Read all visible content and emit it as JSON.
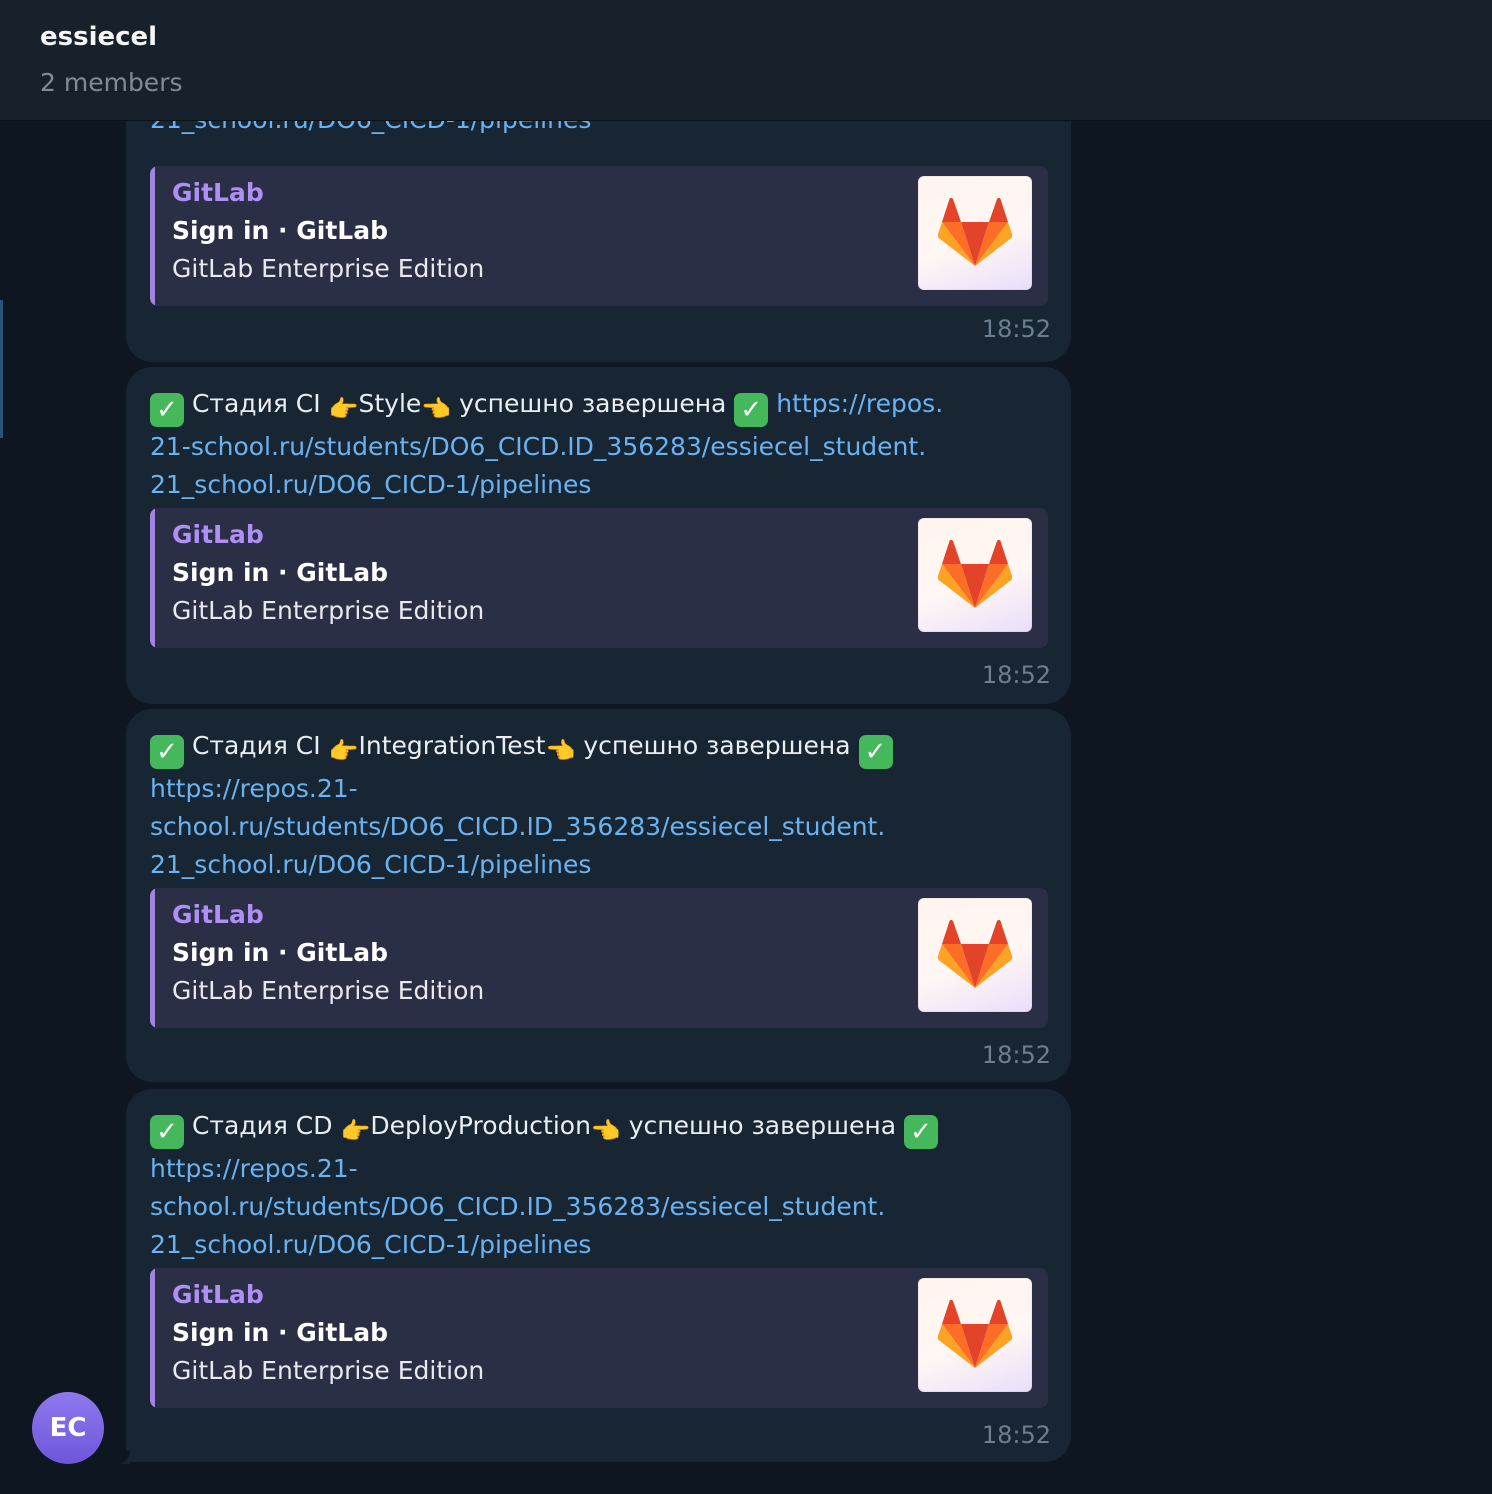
{
  "header": {
    "title": "essiecel",
    "subtitle": "2 members"
  },
  "avatar": {
    "initials": "EC"
  },
  "messages": [
    {
      "text_lines": [],
      "link_lines": [
        "21_school.ru/DO6_CICD-1/pipelines"
      ],
      "preview": {
        "site": "GitLab",
        "title": "Sign in · GitLab",
        "description": "GitLab Enterprise Edition"
      },
      "time": "18:52"
    },
    {
      "check": "✓",
      "stage_prefix": "Стадия CI",
      "stage_name": "Style",
      "stage_suffix": "успешно завершена",
      "link_inline": "https://repos.",
      "link_lines": [
        "21-school.ru/students/DO6_CICD.ID_356283/essiecel_student.",
        "21_school.ru/DO6_CICD-1/pipelines"
      ],
      "preview": {
        "site": "GitLab",
        "title": "Sign in · GitLab",
        "description": "GitLab Enterprise Edition"
      },
      "time": "18:52"
    },
    {
      "check": "✓",
      "stage_prefix": "Стадия CI",
      "stage_name": "IntegrationTest",
      "stage_suffix": "успешно завершена",
      "link_lines": [
        "https://repos.21-",
        "school.ru/students/DO6_CICD.ID_356283/essiecel_student.",
        "21_school.ru/DO6_CICD-1/pipelines"
      ],
      "preview": {
        "site": "GitLab",
        "title": "Sign in · GitLab",
        "description": "GitLab Enterprise Edition"
      },
      "time": "18:52"
    },
    {
      "check": "✓",
      "stage_prefix": "Стадия CD",
      "stage_name": "DeployProduction",
      "stage_suffix": "успешно завершена",
      "link_lines": [
        "https://repos.21-",
        "school.ru/students/DO6_CICD.ID_356283/essiecel_student.",
        "21_school.ru/DO6_CICD-1/pipelines"
      ],
      "preview": {
        "site": "GitLab",
        "title": "Sign in · GitLab",
        "description": "GitLab Enterprise Edition"
      },
      "time": "18:52"
    }
  ],
  "icons": {
    "check": "check-mark-button-icon",
    "hand_right": "backhand-index-pointing-right-icon",
    "hand_left": "backhand-index-pointing-left-icon",
    "gitlab": "gitlab-logo-icon"
  },
  "colors": {
    "background": "#0e1621",
    "bubble": "#182533",
    "link": "#6ab3f3",
    "preview_accent": "#a383e2",
    "check": "#44b85b",
    "avatar": "#7b65e4"
  }
}
